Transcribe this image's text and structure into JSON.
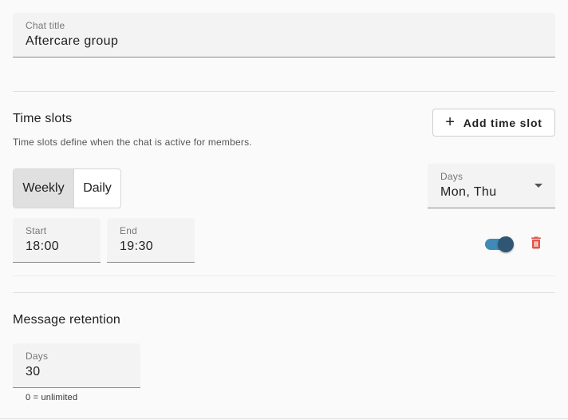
{
  "chat_title": {
    "label": "Chat title",
    "value": "Aftercare group"
  },
  "time_slots": {
    "heading": "Time slots",
    "help": "Time slots define when the chat is active for members.",
    "add_button": {
      "icon": "plus-icon",
      "label": "Add time slot"
    },
    "frequency": {
      "options": [
        "Weekly",
        "Daily"
      ],
      "selected": "Weekly"
    },
    "days": {
      "label": "Days",
      "value": "Mon, Thu"
    },
    "start": {
      "label": "Start",
      "value": "18:00"
    },
    "end": {
      "label": "End",
      "value": "19:30"
    },
    "enabled": true,
    "delete_icon": "trash-icon"
  },
  "retention": {
    "heading": "Message retention",
    "days": {
      "label": "Days",
      "value": "30"
    },
    "hint": "0 = unlimited"
  },
  "colors": {
    "accent": "#3f8ab6",
    "switch_thumb": "#2f5673",
    "delete": "#e2574c",
    "field_bg": "#f3f3f3",
    "selected_segment": "#e0e0e0"
  }
}
